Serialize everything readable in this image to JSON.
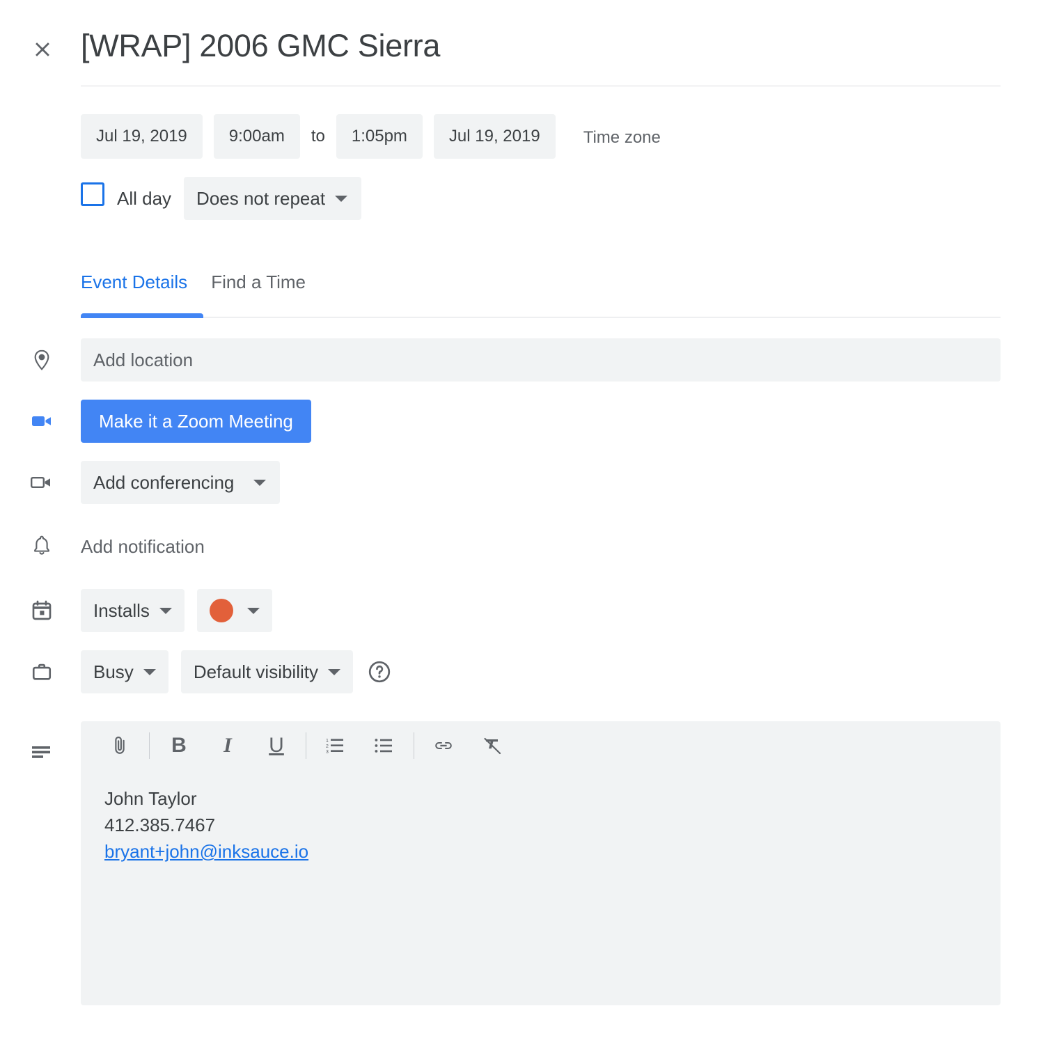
{
  "header": {
    "close_icon": "close-icon",
    "title": "[WRAP] 2006 GMC Sierra"
  },
  "schedule": {
    "start_date": "Jul 19, 2019",
    "start_time": "9:00am",
    "to_label": "to",
    "end_time": "1:05pm",
    "end_date": "Jul 19, 2019",
    "time_zone_label": "Time zone",
    "all_day_label": "All day",
    "all_day_checked": false,
    "repeat_value": "Does not repeat"
  },
  "tabs": [
    {
      "label": "Event Details",
      "active": true
    },
    {
      "label": "Find a Time",
      "active": false
    }
  ],
  "details": {
    "location": {
      "icon": "location-pin-icon",
      "value": "",
      "placeholder": "Add location"
    },
    "zoom": {
      "icon": "zoom-video-icon",
      "button_label": "Make it a Zoom Meeting"
    },
    "conferencing": {
      "icon": "video-camera-icon",
      "value": "Add conferencing"
    },
    "notification": {
      "icon": "bell-icon",
      "label": "Add notification"
    },
    "calendar": {
      "icon": "calendar-icon",
      "value": "Installs",
      "color_label": "event-color",
      "color_hex": "#E2603A"
    },
    "availability": {
      "icon": "briefcase-icon",
      "busy_value": "Busy",
      "visibility_value": "Default visibility",
      "help_icon": "help-circle-icon"
    }
  },
  "description": {
    "icon": "description-lines-icon",
    "toolbar": [
      {
        "name": "attach-file-icon",
        "label": "attach"
      },
      {
        "name": "bold-icon",
        "label": "B"
      },
      {
        "name": "italic-icon",
        "label": "I"
      },
      {
        "name": "underline-icon",
        "label": "U"
      },
      {
        "name": "numbered-list-icon",
        "label": "numbered list"
      },
      {
        "name": "bulleted-list-icon",
        "label": "bulleted list"
      },
      {
        "name": "insert-link-icon",
        "label": "link"
      },
      {
        "name": "clear-formatting-icon",
        "label": "clear formatting"
      }
    ],
    "lines": {
      "name": "John Taylor",
      "phone": "412.385.7467",
      "email": "bryant+john@inksauce.io"
    }
  },
  "colors": {
    "accent_blue": "#4285F4",
    "link_blue": "#1A73E8",
    "chip_gray": "#F1F3F4",
    "text_primary": "#3C4043",
    "text_secondary": "#5F6368",
    "event_orange": "#E2603A"
  }
}
